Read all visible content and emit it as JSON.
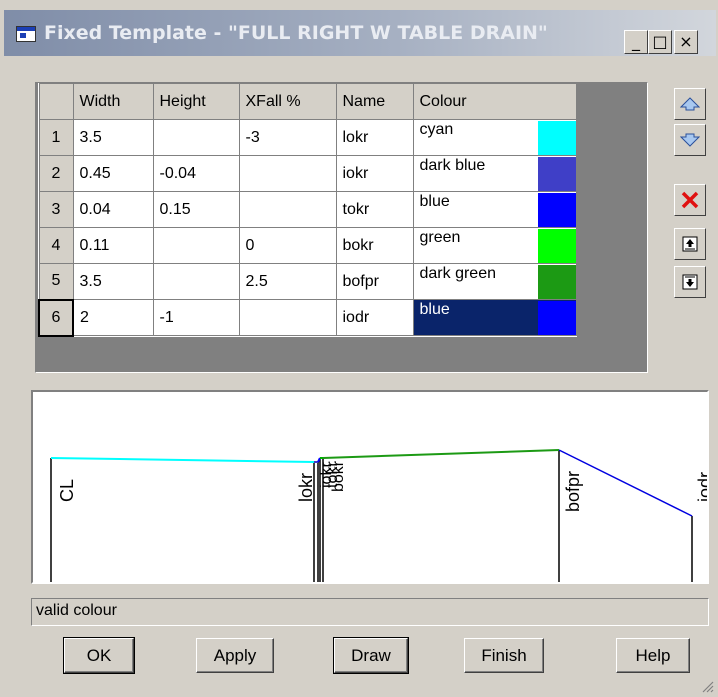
{
  "window": {
    "title": "Fixed Template - \"FULL RIGHT W TABLE DRAIN\"",
    "buttons": {
      "minimize": "_",
      "maximize": "□",
      "close": "×"
    }
  },
  "grid": {
    "headers": [
      "",
      "Width",
      "Height",
      "XFall %",
      "Name",
      "Colour"
    ],
    "rows": [
      {
        "n": "1",
        "width": "3.5",
        "height": "",
        "xfall": "-3",
        "name": "lokr",
        "colour": "cyan",
        "swatch": "#00ffff"
      },
      {
        "n": "2",
        "width": "0.45",
        "height": "-0.04",
        "xfall": "",
        "name": "iokr",
        "colour": "dark blue",
        "swatch": "#3f3fc7"
      },
      {
        "n": "3",
        "width": "0.04",
        "height": "0.15",
        "xfall": "",
        "name": "tokr",
        "colour": "blue",
        "swatch": "#0000ff"
      },
      {
        "n": "4",
        "width": "0.11",
        "height": "",
        "xfall": "0",
        "name": "bokr",
        "colour": "green",
        "swatch": "#00ff00"
      },
      {
        "n": "5",
        "width": "3.5",
        "height": "",
        "xfall": "2.5",
        "name": "bofpr",
        "colour": "dark green",
        "swatch": "#1c9a14"
      },
      {
        "n": "6",
        "width": "2",
        "height": "-1",
        "xfall": "",
        "name": "iodr",
        "colour": "blue",
        "swatch": "#0000ff"
      }
    ]
  },
  "side_buttons": [
    "arrow-up-icon",
    "arrow-down-icon",
    "delete-icon",
    "insert-above-icon",
    "insert-below-icon"
  ],
  "preview": {
    "labels": [
      "CL",
      "lokr",
      "iokr",
      "tokr",
      "bokr",
      "bofpr",
      "iodr"
    ]
  },
  "status": "valid colour",
  "buttons": {
    "ok": "OK",
    "apply": "Apply",
    "draw": "Draw",
    "finish": "Finish",
    "help": "Help"
  },
  "colors": {
    "cyan": "#00ffff",
    "green": "#00b000",
    "blue": "#0000e0",
    "selection": "#0a246a"
  }
}
